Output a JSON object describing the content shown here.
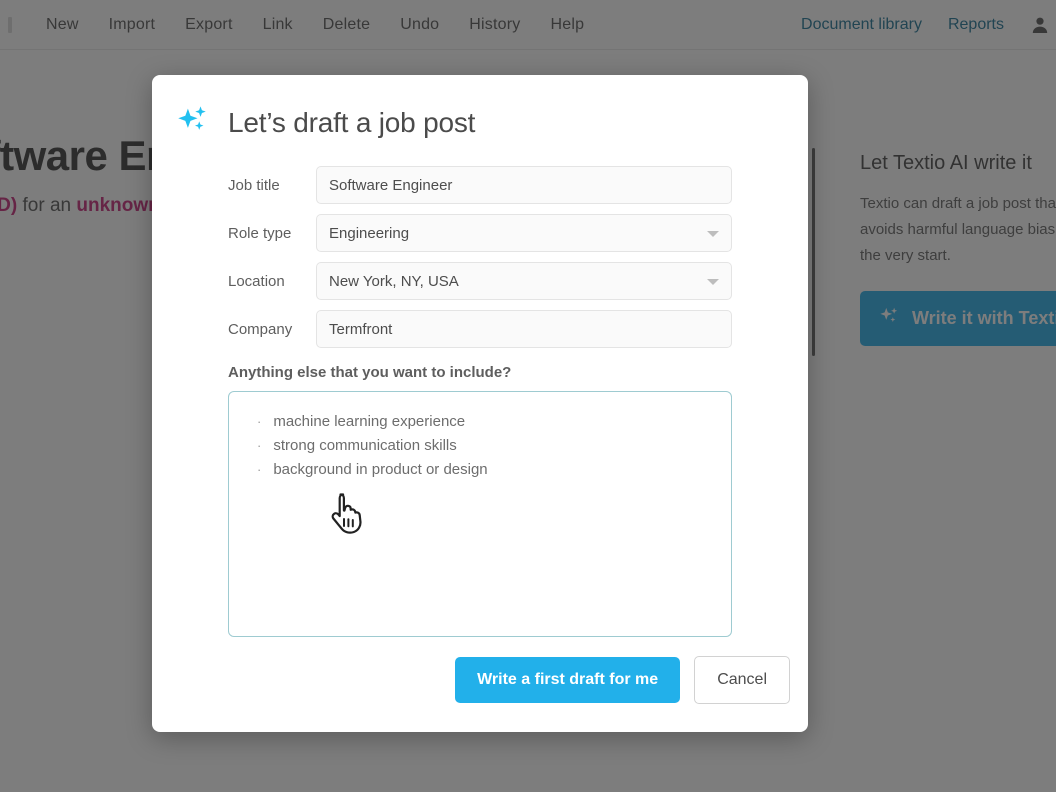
{
  "topnav": {
    "left_items": [
      {
        "label": "New",
        "name": "new"
      },
      {
        "label": "Import",
        "name": "import"
      },
      {
        "label": "Export",
        "name": "export"
      },
      {
        "label": "Link",
        "name": "link"
      },
      {
        "label": "Delete",
        "name": "delete"
      },
      {
        "label": "Undo",
        "name": "undo"
      },
      {
        "label": "History",
        "name": "history"
      },
      {
        "label": "Help",
        "name": "help"
      }
    ],
    "right_links": [
      {
        "label": "Document library",
        "name": "document-library"
      },
      {
        "label": "Reports",
        "name": "reports"
      }
    ],
    "avatar_icon": "user-icon",
    "link_color": "#0f6a8e"
  },
  "document": {
    "title": "Software Engineer",
    "subtitle_prefix": "",
    "subtitle_req": "(reqID)",
    "subtitle_mid": " for an ",
    "subtitle_unknown": "unknown"
  },
  "side_panel": {
    "title": "Let Textio AI write it",
    "body": "Textio can draft a job post that avoids harmful language bias from the very start.",
    "button_label": "Write it with Textio",
    "button_icon": "sparkle-icon",
    "button_color": "#1aa9e8"
  },
  "modal": {
    "icon": "sparkle-icon",
    "title": "Let’s draft a job post",
    "fields": [
      {
        "label": "Job title",
        "value": "Software Engineer",
        "type": "text",
        "name": "job-title"
      },
      {
        "label": "Role type",
        "value": "Engineering",
        "type": "select",
        "name": "role-type"
      },
      {
        "label": "Location",
        "value": "New York, NY, USA",
        "type": "select",
        "name": "location"
      },
      {
        "label": "Company",
        "value": "Termfront",
        "type": "text",
        "name": "company"
      }
    ],
    "extra_label": "Anything else that you want to include?",
    "extra_bullets": [
      "machine learning experience",
      "strong communication skills",
      "background in product or design"
    ],
    "bullet_glyph": "·",
    "primary_button": "Write a first draft for me",
    "secondary_button": "Cancel",
    "primary_color": "#22b0ea",
    "textarea_border_color": "#9ecbd1",
    "cursor_icon": "pointing-hand-cursor"
  }
}
